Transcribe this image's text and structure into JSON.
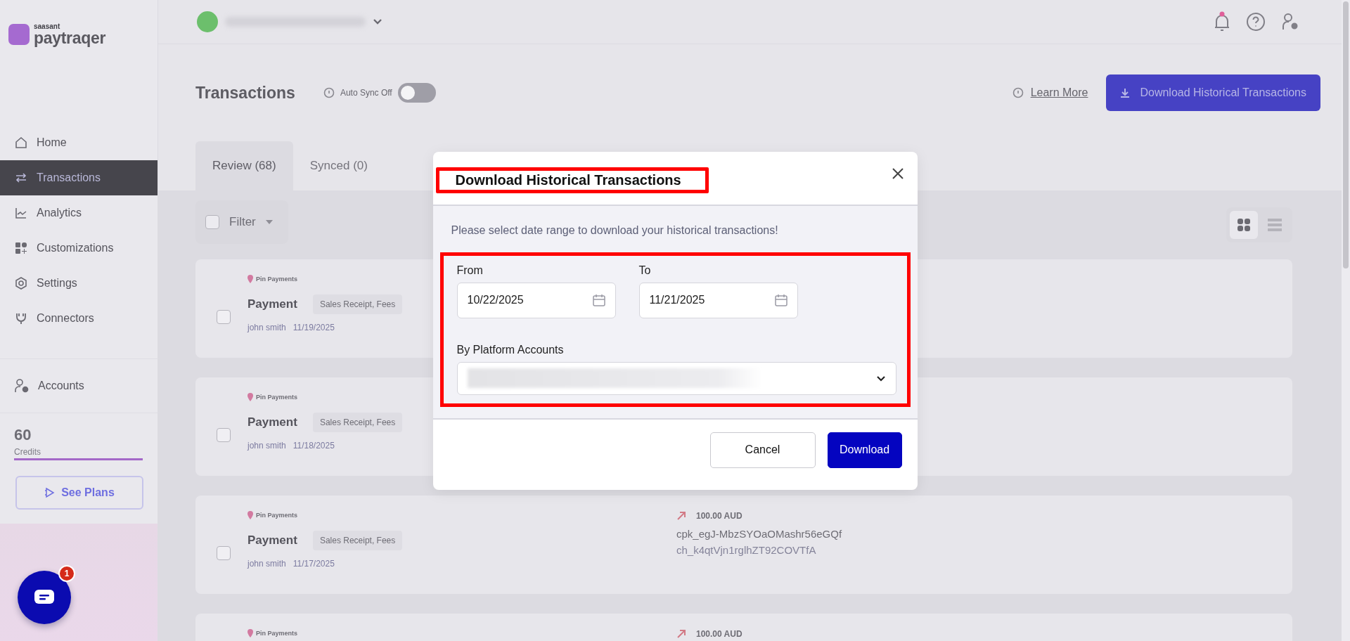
{
  "sidebar": {
    "logo": {
      "brand": "saasant",
      "product": "paytraqer"
    },
    "nav": [
      {
        "kind": "home",
        "label": "Home",
        "selected": false
      },
      {
        "kind": "transfer",
        "label": "Transactions",
        "selected": true
      },
      {
        "kind": "chart",
        "label": "Analytics",
        "selected": false
      },
      {
        "kind": "blocks",
        "label": "Customizations",
        "selected": false
      },
      {
        "kind": "gear",
        "label": "Settings",
        "selected": false
      },
      {
        "kind": "plug",
        "label": "Connectors",
        "selected": false
      }
    ],
    "accounts": "Accounts",
    "credits": {
      "value": "60",
      "label": "Credits",
      "level": 1
    },
    "see_plans": "See Plans"
  },
  "chat": {
    "badge": "1"
  },
  "header": {
    "notifications_unread": true
  },
  "page": {
    "title": "Transactions",
    "auto_sync": {
      "label": "Auto Sync Off",
      "on": false
    },
    "learn_more": "Learn More",
    "download_button": "Download Historical Transactions"
  },
  "tabs": [
    {
      "label": "Review (68)",
      "selected": true
    },
    {
      "label": "Synced (0)",
      "selected": false
    }
  ],
  "filter": {
    "label": "Filter",
    "checked": false
  },
  "view_toggle": [
    {
      "kind": "grid",
      "selected": true
    },
    {
      "kind": "list",
      "selected": false
    }
  ],
  "transactions": [
    {
      "platform": "Pin Payments",
      "type": "Payment",
      "tags": "Sales Receipt, Fees",
      "customer": "john smith",
      "date": "11/19/2025",
      "checked": false
    },
    {
      "platform": "Pin Payments",
      "type": "Payment",
      "tags": "Sales Receipt, Fees",
      "customer": "john smith",
      "date": "11/18/2025",
      "checked": false
    },
    {
      "platform": "Pin Payments",
      "type": "Payment",
      "tags": "Sales Receipt, Fees",
      "customer": "john smith",
      "date": "11/17/2025",
      "checked": false,
      "amount": "100.00 AUD",
      "reference": "cpk_egJ-MbzSYOaOMashr56eGQf",
      "charge_id": "ch_k4qtVjn1rglhZT92COVTfA"
    },
    {
      "platform": "Pin Payments",
      "amount": "100.00 AUD"
    }
  ],
  "dialog": {
    "title": "Download Historical Transactions",
    "description": "Please select date range to download your historical transactions!",
    "from": {
      "label": "From",
      "value": "10/22/2025"
    },
    "to": {
      "label": "To",
      "value": "11/21/2025"
    },
    "accounts": {
      "label": "By Platform Accounts"
    },
    "buttons": [
      {
        "kind": "secondary",
        "label": "Cancel"
      },
      {
        "kind": "primary",
        "label": "Download"
      }
    ]
  }
}
